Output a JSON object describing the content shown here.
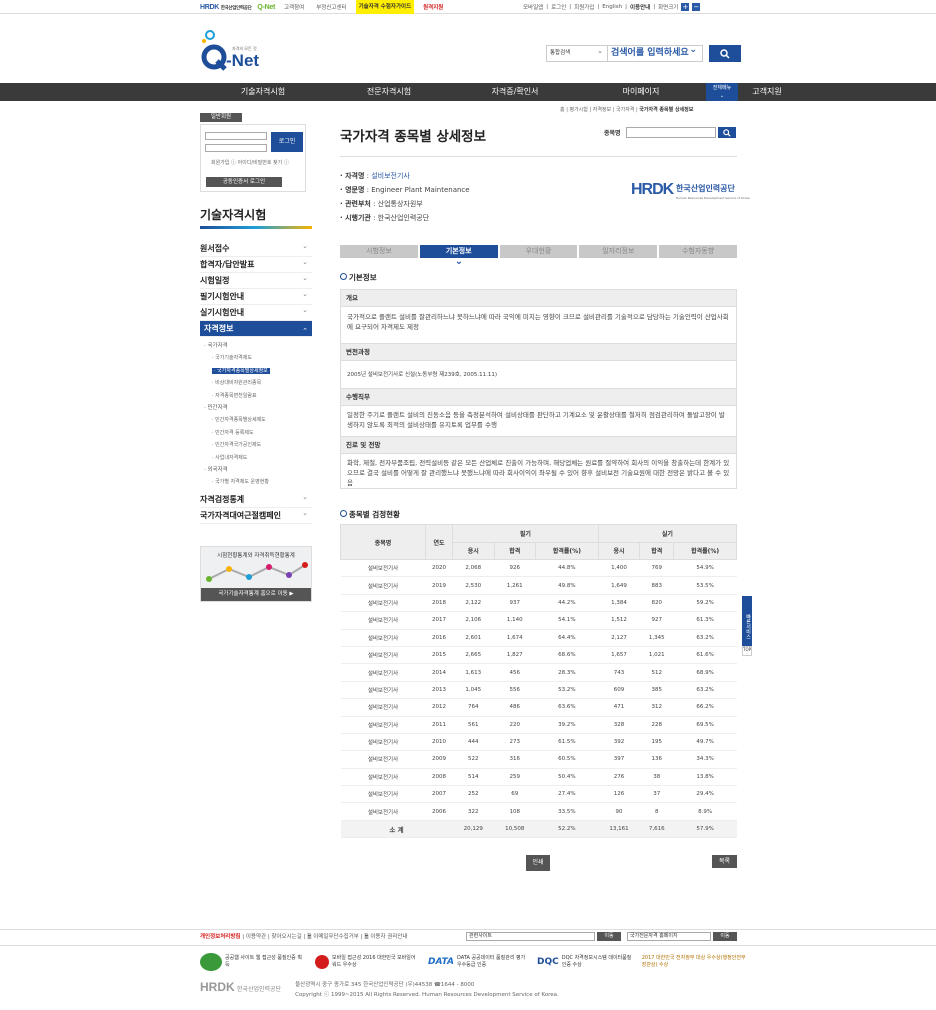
{
  "topbar": {
    "hrdk": "HRDK",
    "hrdk_sub": "한국산업인력공단",
    "qnet": "Q-Net",
    "links": [
      "고객참여",
      "부정신고센터",
      "기술자격 수험자가이드",
      "원격지원"
    ],
    "right_links": [
      "모바일앱",
      "로그인",
      "회원가입",
      "English",
      "이용안내",
      "화면크기"
    ],
    "zoom_in": "+",
    "zoom_out": "−"
  },
  "logo": {
    "text": "Q-Net",
    "sub": "자격의 모든 것"
  },
  "search": {
    "select": "통합검색",
    "placeholder": "검색어를 입력하세요"
  },
  "gnb": [
    "기술자격시험",
    "전문자격시험",
    "자격증/확인서",
    "마이페이지",
    "고객지원"
  ],
  "allmenu": "전체메뉴",
  "breadcrumb": {
    "path": "홈 | 평가시험 | 자격정보 | 국가자격 | ",
    "current": "국가자격 종목별 상세정보"
  },
  "login": {
    "tag": "일반회원",
    "button": "로그인",
    "links": "회원가입 ⓘ 아이디/비밀번호 찾기 ⓘ",
    "cert": "공동인증서 로그인"
  },
  "leftmenu": {
    "title": "기술자격시험",
    "items": [
      "원서접수",
      "합격자/답안발표",
      "시험일정",
      "필기시험안내",
      "실기시험안내"
    ],
    "active": "자격정보",
    "sub": {
      "national": "· 국가자격",
      "n1": "· 국가기술자격제도",
      "n2": "· 국가자격종목별상세정보",
      "n3": "· 비상대비자원관리종목",
      "n4": "· 자격종목변천일람표",
      "private": "· 민간자격",
      "p1": "· 민간자격종목별상세제도",
      "p2": "· 민간자격 등록제도",
      "p3": "· 민간자격국가공인제도",
      "p4": "· 사업내자격제도",
      "foreign": "· 외국자격",
      "f1": "· 국가별 자격제도 운영현황"
    },
    "after": [
      "자격검정통계",
      "국가자격대여근절캠페인"
    ]
  },
  "stat": {
    "title": "시험현황통계와 자격취득현황통계",
    "button": "국가기술자격통계 홈으로 이동 ▶"
  },
  "content": {
    "title": "국가자격 종목별 상세정보",
    "search_label": "종목명",
    "info": [
      {
        "k": "· 자격명",
        "v": " : 설비보전기사"
      },
      {
        "k": "· 영문명",
        "v": " : Engineer Plant Maintenance"
      },
      {
        "k": "· 관련부처",
        "v": " : 산업통상자원부"
      },
      {
        "k": "· 시행기관",
        "v": " : 한국산업인력공단"
      }
    ],
    "hrdk_logo": "HRDK",
    "hrdk_logo_sub": "한국산업인력공단",
    "hrdk_logo_en": "Human Resources Development Service of Korea",
    "tabs": [
      "시험정보",
      "기본정보",
      "우대현황",
      "일자리정보",
      "수험자동향"
    ],
    "sec1": "기본정보",
    "basic": [
      {
        "h": "개요",
        "b": "국가적으로 플랜트 설비를 잘관리하느냐 못하느냐에 따라 국익에 미치는 영향이 크므로 설비관리를 기술적으로 담당하는 기술인력이 산업사회에 요구되어 자격제도 제정"
      },
      {
        "h": "변천과정",
        "b": "2005년 설비보전기사로 신설(노동부령 제239호, 2005.11.11)"
      },
      {
        "h": "수행직무",
        "b": "일정한 주기로 플랜트 설비의 진동소음 등을 측정분석하여 설비상태를 판단하고 기계요소 및 윤활상태를 철저히 점검관리하여 돌발고장이 발생하지 않도록 최적의 설비상태를 유지토록 업무를 수행"
      },
      {
        "h": "진로 및 전망",
        "b": "화학, 제철, 전자부품조립, 전력설비등 같은 모든 산업체로 진출이 가능하며, 해당업체는 원료를 절약하여 회사의 이익을 창출하는데 한계가 있으므로 결국 설비를 어떻게 잘 관리했느냐 못했느냐에 따라 회사이익이 좌우될 수 있어 향후 설비보전 기술요원에 대한 전망은 밝다고 볼 수 있음"
      }
    ],
    "sec2": "종목별 검정현황",
    "table": {
      "h_item": "종목명",
      "h_year": "연도",
      "h_written": "필기",
      "h_practical": "실기",
      "sub": [
        "응시",
        "합격",
        "합격률(%)",
        "응시",
        "합격",
        "합격률(%)"
      ],
      "rows": [
        [
          "설비보전기사",
          "2020",
          "2,068",
          "926",
          "44.8%",
          "1,400",
          "769",
          "54.9%"
        ],
        [
          "설비보전기사",
          "2019",
          "2,530",
          "1,261",
          "49.8%",
          "1,649",
          "883",
          "53.5%"
        ],
        [
          "설비보전기사",
          "2018",
          "2,122",
          "937",
          "44.2%",
          "1,384",
          "820",
          "59.2%"
        ],
        [
          "설비보전기사",
          "2017",
          "2,106",
          "1,140",
          "54.1%",
          "1,512",
          "927",
          "61.3%"
        ],
        [
          "설비보전기사",
          "2016",
          "2,601",
          "1,674",
          "64.4%",
          "2,127",
          "1,345",
          "63.2%"
        ],
        [
          "설비보전기사",
          "2015",
          "2,665",
          "1,827",
          "68.6%",
          "1,657",
          "1,021",
          "61.6%"
        ],
        [
          "설비보전기사",
          "2014",
          "1,613",
          "456",
          "28.3%",
          "743",
          "512",
          "68.9%"
        ],
        [
          "설비보전기사",
          "2013",
          "1,045",
          "556",
          "53.2%",
          "609",
          "385",
          "63.2%"
        ],
        [
          "설비보전기사",
          "2012",
          "764",
          "486",
          "63.6%",
          "471",
          "312",
          "66.2%"
        ],
        [
          "설비보전기사",
          "2011",
          "561",
          "220",
          "39.2%",
          "328",
          "228",
          "69.5%"
        ],
        [
          "설비보전기사",
          "2010",
          "444",
          "273",
          "61.5%",
          "392",
          "195",
          "49.7%"
        ],
        [
          "설비보전기사",
          "2009",
          "522",
          "316",
          "60.5%",
          "397",
          "136",
          "34.3%"
        ],
        [
          "설비보전기사",
          "2008",
          "514",
          "259",
          "50.4%",
          "276",
          "38",
          "13.8%"
        ],
        [
          "설비보전기사",
          "2007",
          "252",
          "69",
          "27.4%",
          "126",
          "37",
          "29.4%"
        ],
        [
          "설비보전기사",
          "2006",
          "322",
          "108",
          "33.5%",
          "90",
          "8",
          "8.9%"
        ]
      ],
      "total": [
        "소 계",
        "20,129",
        "10,508",
        "52.2%",
        "13,161",
        "7,616",
        "57.9%"
      ]
    },
    "print": "인쇄",
    "list": "목록"
  },
  "quick": "빠른서비스",
  "quick_top": "TOP",
  "footer": {
    "privacy": "개인정보처리방침",
    "links": " | 이용약관 | 찾아오시는길 | 🗎 이메일무단수집거부 | 🗎 이용자 권리안내",
    "select1": "관련사이트",
    "select2": "국가전문자격 홈페이지",
    "go": "이동",
    "banners": [
      {
        "name": "공공웹 사이트 웹 접근성 품질인증 획득",
        "color": "#3a9a3a"
      },
      {
        "name": "모바일 접근성 2016 대한민국 모바일어워드 우수상",
        "color": "#d51c1c"
      },
      {
        "name": "DATA 공공데이터 품질관리 평가 우수등급 인증",
        "color": "#1e6ec8"
      },
      {
        "name": "DQC 자격정보시스템 데이터품질인증 수상",
        "color": "#1e4e9a"
      },
      {
        "name": "2017 대한민국 전자정부 대상 우수상(행정안전부 장관상) 수상",
        "color": "#f0a000"
      }
    ],
    "address": "울산광역시 중구 종가로 345 한국산업인력공단 (우)44538 ☎1644 - 8000",
    "copyright": "Copyright ⓒ 1999~2015 All Rights Reserved. Human Resources Development Service of Korea."
  },
  "colors": {
    "brand": "#1e4e9a",
    "nav": "#3a3a3a",
    "highlight": "#ffee00"
  }
}
